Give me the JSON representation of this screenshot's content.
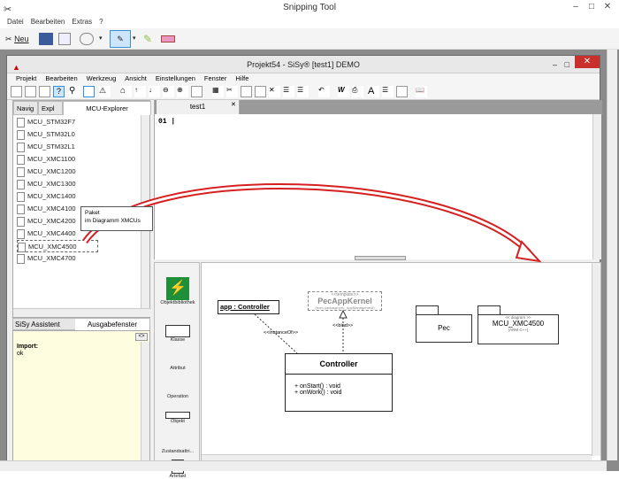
{
  "snipping_tool": {
    "title": "Snipping Tool",
    "menu": [
      "Datei",
      "Bearbeiten",
      "Extras",
      "?"
    ],
    "toolbar": {
      "new_label": "Neu"
    }
  },
  "sisy": {
    "title": "Projekt54 - SiSy® [test1] DEMO",
    "menu": [
      "Projekt",
      "Bearbeiten",
      "Werkzeug",
      "Ansicht",
      "Einstellungen",
      "Fenster",
      "Hilfe"
    ],
    "left_tabs": [
      "Navig",
      "Expl",
      "MCU-Explorer"
    ],
    "mcu_list": [
      "MCU_STM32F7",
      "MCU_STM32L0",
      "MCU_STM32L1",
      "MCU_XMC1100",
      "MCU_XMC1200",
      "MCU_XMC1300",
      "MCU_XMC1400",
      "MCU_XMC4100",
      "MCU_XMC4200",
      "MCU_XMC4400",
      "MCU_XMC4500",
      "MCU_XMC4700"
    ],
    "tooltip": {
      "line1": "Paket",
      "line2": "im Diagramm XMCUs"
    },
    "lower_tabs": [
      "SiSy Assistent",
      "Ausgabefenster"
    ],
    "output": {
      "label": "Import:",
      "value": "ok"
    },
    "editor": {
      "tab": "test1",
      "line": "01 |"
    },
    "toolbox": [
      "Objektbibliothek",
      "Klasse",
      "Attribut",
      "Operation",
      "Objekt",
      "Zustandsattri...",
      "Artefakt"
    ],
    "diagram": {
      "app_controller": "app : Controller",
      "instance_of": "<<instanceOf>>",
      "pec_stereo": "<<template>>",
      "pec_name": "PecAppKernel",
      "pec_sub": "(from package:pec_AppManagement)",
      "bind": "<<bind>>",
      "controller": "Controller",
      "op1": "+ onStart() : void",
      "op2": "+ onWork() : void",
      "pec_pkg": "Pec",
      "mcu_stereo": "<< diagram >>",
      "mcu_name": "MCU_XMC4500",
      "mcu_sub": "(ARM C++)"
    }
  }
}
